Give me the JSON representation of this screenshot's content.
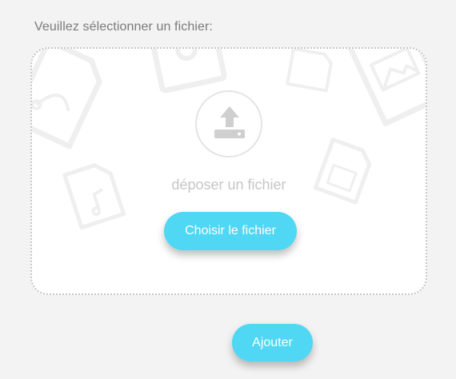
{
  "form": {
    "prompt": "Veuillez sélectionner un fichier:"
  },
  "dropzone": {
    "drop_label": "déposer un fichier",
    "choose_button": "Choisir le fichier",
    "upload_icon": "upload-tray-icon",
    "background_icons": [
      "vector-file-icon",
      "image-file-icon",
      "photo-file-icon",
      "mp3-file-icon",
      "png-file-icon"
    ]
  },
  "actions": {
    "add_button": "Ajouter"
  },
  "colors": {
    "accent": "#4fd7f3",
    "page_background": "#f3f3f3",
    "dropzone_background": "#ffffff"
  }
}
